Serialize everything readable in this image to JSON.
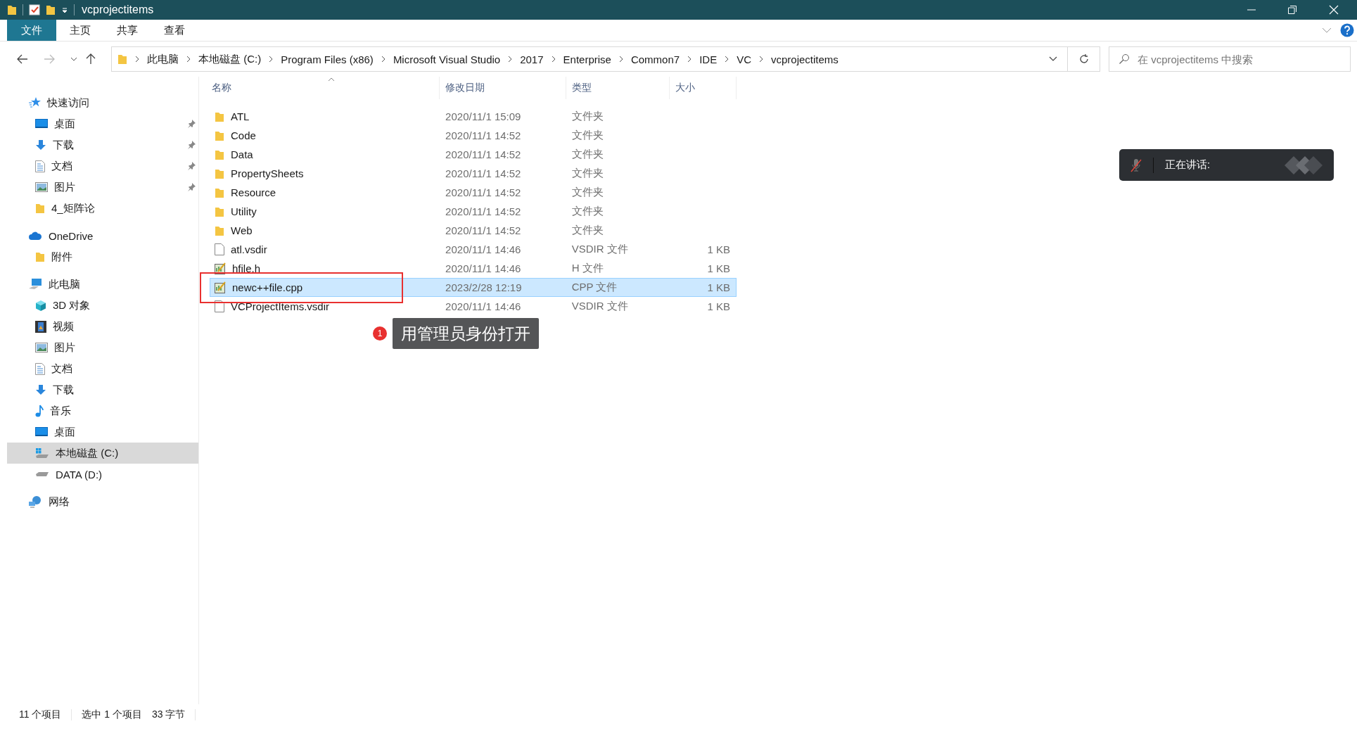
{
  "window": {
    "title": "vcprojectitems"
  },
  "ribbon_tabs": [
    {
      "label": "文件",
      "selected": true
    },
    {
      "label": "主页",
      "selected": false
    },
    {
      "label": "共享",
      "selected": false
    },
    {
      "label": "查看",
      "selected": false
    }
  ],
  "address_bar": {
    "breadcrumbs": [
      "此电脑",
      "本地磁盘 (C:)",
      "Program Files (x86)",
      "Microsoft Visual Studio",
      "2017",
      "Enterprise",
      "Common7",
      "IDE",
      "VC",
      "vcprojectitems"
    ]
  },
  "search": {
    "placeholder": "在 vcprojectitems 中搜索"
  },
  "sidebar": {
    "items": [
      {
        "label": "快速访问",
        "kind": "star",
        "selected": false,
        "children": [
          {
            "label": "桌面",
            "kind": "desktop",
            "pinned": true,
            "selected": false
          },
          {
            "label": "下载",
            "kind": "download",
            "pinned": true,
            "selected": false
          },
          {
            "label": "文档",
            "kind": "document",
            "pinned": true,
            "selected": false
          },
          {
            "label": "图片",
            "kind": "picture",
            "pinned": true,
            "selected": false
          },
          {
            "label": "4_矩阵论",
            "kind": "folder",
            "pinned": false,
            "selected": false
          }
        ]
      },
      {
        "label": "OneDrive",
        "kind": "cloud",
        "selected": false,
        "children": [
          {
            "label": "附件",
            "kind": "folder",
            "pinned": false,
            "selected": false
          }
        ]
      },
      {
        "label": "此电脑",
        "kind": "pc",
        "selected": false,
        "children": [
          {
            "label": "3D 对象",
            "kind": "cube",
            "pinned": false,
            "selected": false
          },
          {
            "label": "视频",
            "kind": "video",
            "pinned": false,
            "selected": false
          },
          {
            "label": "图片",
            "kind": "picture",
            "pinned": false,
            "selected": false
          },
          {
            "label": "文档",
            "kind": "document",
            "pinned": false,
            "selected": false
          },
          {
            "label": "下载",
            "kind": "download",
            "pinned": false,
            "selected": false
          },
          {
            "label": "音乐",
            "kind": "music",
            "pinned": false,
            "selected": false
          },
          {
            "label": "桌面",
            "kind": "desktop",
            "pinned": false,
            "selected": false
          },
          {
            "label": "本地磁盘 (C:)",
            "kind": "system-drive",
            "pinned": false,
            "selected": true
          },
          {
            "label": "DATA (D:)",
            "kind": "drive",
            "pinned": false,
            "selected": false
          }
        ]
      },
      {
        "label": "网络",
        "kind": "network",
        "selected": false
      }
    ]
  },
  "table": {
    "columns": [
      "名称",
      "修改日期",
      "类型",
      "大小"
    ],
    "rows": [
      {
        "kind": "folder",
        "name": "ATL",
        "date": "2020/11/1 15:09",
        "type": "文件夹",
        "selected": false
      },
      {
        "kind": "folder",
        "name": "Code",
        "date": "2020/11/1 14:52",
        "type": "文件夹",
        "selected": false
      },
      {
        "kind": "folder",
        "name": "Data",
        "date": "2020/11/1 14:52",
        "type": "文件夹",
        "selected": false
      },
      {
        "kind": "folder",
        "name": "PropertySheets",
        "date": "2020/11/1 14:52",
        "type": "文件夹",
        "selected": false
      },
      {
        "kind": "folder",
        "name": "Resource",
        "date": "2020/11/1 14:52",
        "type": "文件夹",
        "selected": false
      },
      {
        "kind": "folder",
        "name": "Utility",
        "date": "2020/11/1 14:52",
        "type": "文件夹",
        "selected": false
      },
      {
        "kind": "folder",
        "name": "Web",
        "date": "2020/11/1 14:52",
        "type": "文件夹",
        "selected": false
      },
      {
        "kind": "file",
        "name": "atl.vsdir",
        "date": "2020/11/1 14:46",
        "type": "VSDIR 文件",
        "size": "1 KB",
        "selected": false
      },
      {
        "kind": "source",
        "name": "hfile.h",
        "date": "2020/11/1 14:46",
        "type": "H 文件",
        "size": "1 KB",
        "selected": false
      },
      {
        "kind": "source",
        "name": "newc++file.cpp",
        "date": "2023/2/28 12:19",
        "type": "CPP 文件",
        "size": "1 KB",
        "selected": true
      },
      {
        "kind": "file",
        "name": "VCProjectItems.vsdir",
        "date": "2020/11/1 14:46",
        "type": "VSDIR 文件",
        "size": "1 KB",
        "selected": false
      }
    ]
  },
  "annotation": {
    "badge": "1",
    "label": "用管理员身份打开"
  },
  "status_bar": {
    "item_count": "11 个项目",
    "selection": "选中 1 个项目",
    "size": "33 字节"
  },
  "voice_popup": {
    "label": "正在讲话:",
    "muted": true
  }
}
